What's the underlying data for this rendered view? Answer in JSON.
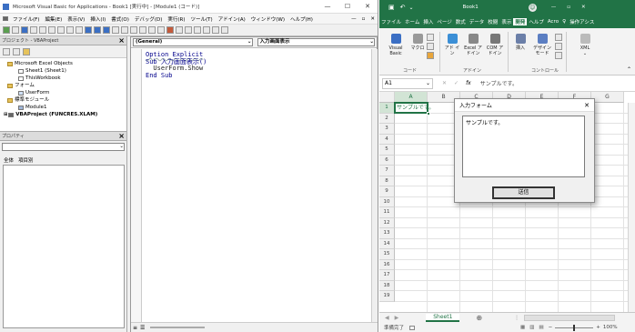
{
  "vbe": {
    "title": "Microsoft Visual Basic for Applications - Book1 [実行中] - [Module1 (コード)]",
    "menus": [
      "ファイル(F)",
      "編集(E)",
      "表示(V)",
      "挿入(I)",
      "書式(O)",
      "デバッグ(D)",
      "実行(R)",
      "ツール(T)",
      "アドイン(A)",
      "ウィンドウ(W)",
      "ヘルプ(H)"
    ],
    "project_panel_title": "プロジェクト - VBAProject",
    "project_tree": [
      "Microsoft Excel Objects",
      "Sheet1 (Sheet1)",
      "ThisWorkbook",
      "フォーム",
      "UserForm",
      "標準モジュール",
      "Module1",
      "VBAProject (FUNCRES.XLAM)"
    ],
    "properties_panel_title": "プロパティ",
    "properties_tabs": [
      "全体",
      "項目別"
    ],
    "object_combo": "(General)",
    "proc_combo": "入力画面表示",
    "code_lines": [
      "Option Explicit",
      "Sub 入力画面表示()",
      "  UserForm.Show",
      "End Sub"
    ]
  },
  "excel": {
    "title": "Book1",
    "ribbon_tabs": [
      "ファイル",
      "ホーム",
      "挿入",
      "ページ",
      "数式",
      "データ",
      "校閲",
      "表示",
      "開発",
      "ヘルプ",
      "Acro",
      "操作アシス"
    ],
    "active_tab": "開発",
    "ribbon_items": {
      "visual_basic": "Visual Basic",
      "macro": "マクロ",
      "addin": "アド イン",
      "excel_addin": "Excel アドイン",
      "com_addin": "COM アドイン",
      "insert": "挿入",
      "design_mode": "デザイン モード",
      "xml": "XML"
    },
    "ribbon_groups": [
      "コード",
      "アドイン",
      "コントロール"
    ],
    "name_box": "A1",
    "formula": "サンプルです。",
    "columns": [
      "A",
      "B",
      "C",
      "D",
      "E",
      "F",
      "G"
    ],
    "rows": [
      "1",
      "2",
      "3",
      "4",
      "5",
      "6",
      "7",
      "8",
      "9",
      "10",
      "11",
      "12",
      "13",
      "14",
      "15",
      "16",
      "17",
      "18",
      "19"
    ],
    "cell_a1": "サンプルです。",
    "sheet_tab": "Sheet1",
    "status": "準備完了",
    "zoom": "100%"
  },
  "userform": {
    "title": "入力フォーム",
    "textbox_value": "サンプルです。",
    "button_label": "送信"
  }
}
